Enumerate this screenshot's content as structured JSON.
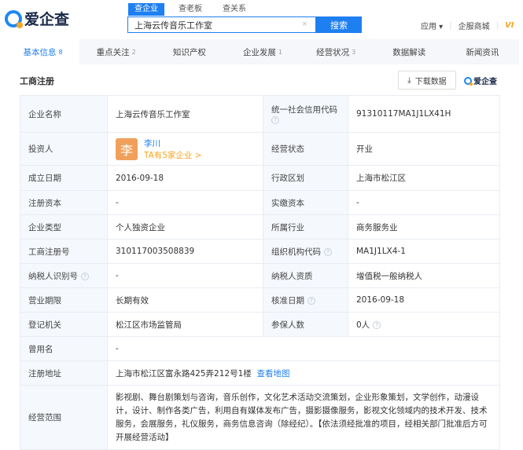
{
  "header": {
    "logo": "爱企查",
    "search_tabs": [
      "查企业",
      "查老板",
      "查关系"
    ],
    "search_value": "上海云传音乐工作室",
    "clear": "×",
    "search_button": "搜索",
    "nav": [
      "应用 ▾",
      "企服商城",
      "VI"
    ]
  },
  "tabs": [
    {
      "label": "基本信息",
      "count": "8"
    },
    {
      "label": "重点关注",
      "count": "2"
    },
    {
      "label": "知识产权",
      "count": ""
    },
    {
      "label": "企业发展",
      "count": "1"
    },
    {
      "label": "经营状况",
      "count": "3"
    },
    {
      "label": "数据解读",
      "count": ""
    },
    {
      "label": "新闻资讯",
      "count": ""
    }
  ],
  "section": {
    "title": "工商注册",
    "download": "下载数据",
    "download_icon": "⤓",
    "brand": "爱企查"
  },
  "table": {
    "company_name_label": "企业名称",
    "company_name": "上海云传音乐工作室",
    "credit_code_label": "统一社会信用代码",
    "credit_code": "91310117MA1J1LX41H",
    "investor_label": "投资人",
    "investor_avatar": "李",
    "investor_name": "李川",
    "investor_link": "TA有5家企业 >",
    "status_label": "经营状态",
    "status": "开业",
    "founded_label": "成立日期",
    "founded": "2016-09-18",
    "region_label": "行政区划",
    "region": "上海市松江区",
    "reg_capital_label": "注册资本",
    "reg_capital": "-",
    "paid_capital_label": "实缴资本",
    "paid_capital": "-",
    "type_label": "企业类型",
    "type": "个人独资企业",
    "industry_label": "所属行业",
    "industry": "商务服务业",
    "reg_no_label": "工商注册号",
    "reg_no": "310117003508839",
    "org_code_label": "组织机构代码",
    "org_code": "MA1J1LX4-1",
    "taxpayer_id_label": "纳税人识别号",
    "taxpayer_id": "-",
    "taxpayer_qual_label": "纳税人资质",
    "taxpayer_qual": "增值税一般纳税人",
    "term_label": "营业期限",
    "term": "长期有效",
    "approval_label": "核准日期",
    "approval": "2016-09-18",
    "authority_label": "登记机关",
    "authority": "松江区市场监管局",
    "insured_label": "参保人数",
    "insured": "0人",
    "former_name_label": "曾用名",
    "former_name": "-",
    "address_label": "注册地址",
    "address": "上海市松江区富永路425弄212号1楼",
    "map_link": "查看地图",
    "scope_label": "经营范围",
    "scope": "影视剧、舞台剧策划与咨询，音乐创作，文化艺术活动交流策划，企业形象策划，文学创作，动漫设计，设计、制作各类广告，利用自有媒体发布广告，摄影摄像服务，影视文化领域内的技术开发、技术服务，会展服务，礼仪服务，商务信息咨询（除经纪）。【依法须经批准的项目，经相关部门批准后方可开展经营活动】",
    "help": "?"
  }
}
